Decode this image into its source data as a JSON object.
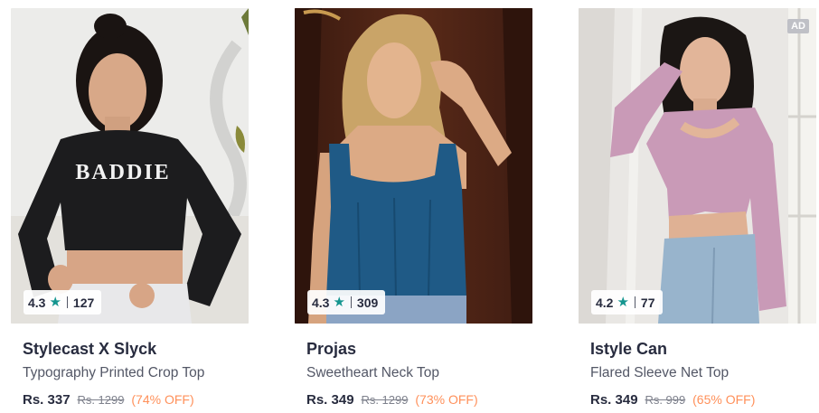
{
  "products": [
    {
      "brand": "Stylecast X Slyck",
      "name": "Typography Printed Crop Top",
      "rating": "4.3",
      "rating_count": "127",
      "price": "Rs. 337",
      "mrp": "Rs. 1299",
      "discount": "(74% OFF)",
      "print_text": "BADDIE",
      "top_color": "#1c1c1e",
      "background": "#ececea"
    },
    {
      "brand": "Projas",
      "name": "Sweetheart Neck Top",
      "rating": "4.3",
      "rating_count": "309",
      "price": "Rs. 349",
      "mrp": "Rs. 1299",
      "discount": "(73% OFF)",
      "top_color": "#1f5a86",
      "background": "#4a2316"
    },
    {
      "brand": "Istyle Can",
      "name": "Flared Sleeve Net Top",
      "rating": "4.2",
      "rating_count": "77",
      "price": "Rs. 349",
      "mrp": "Rs. 999",
      "discount": "(65% OFF)",
      "ad_label": "AD",
      "top_color": "#c99ab7",
      "background": "#e9e7e4"
    }
  ],
  "icons": {
    "rating_star": "star-icon"
  },
  "colors": {
    "rating_star": "#14958f",
    "discount": "#ff905a",
    "text_primary": "#282c3f",
    "text_secondary": "#535766"
  }
}
